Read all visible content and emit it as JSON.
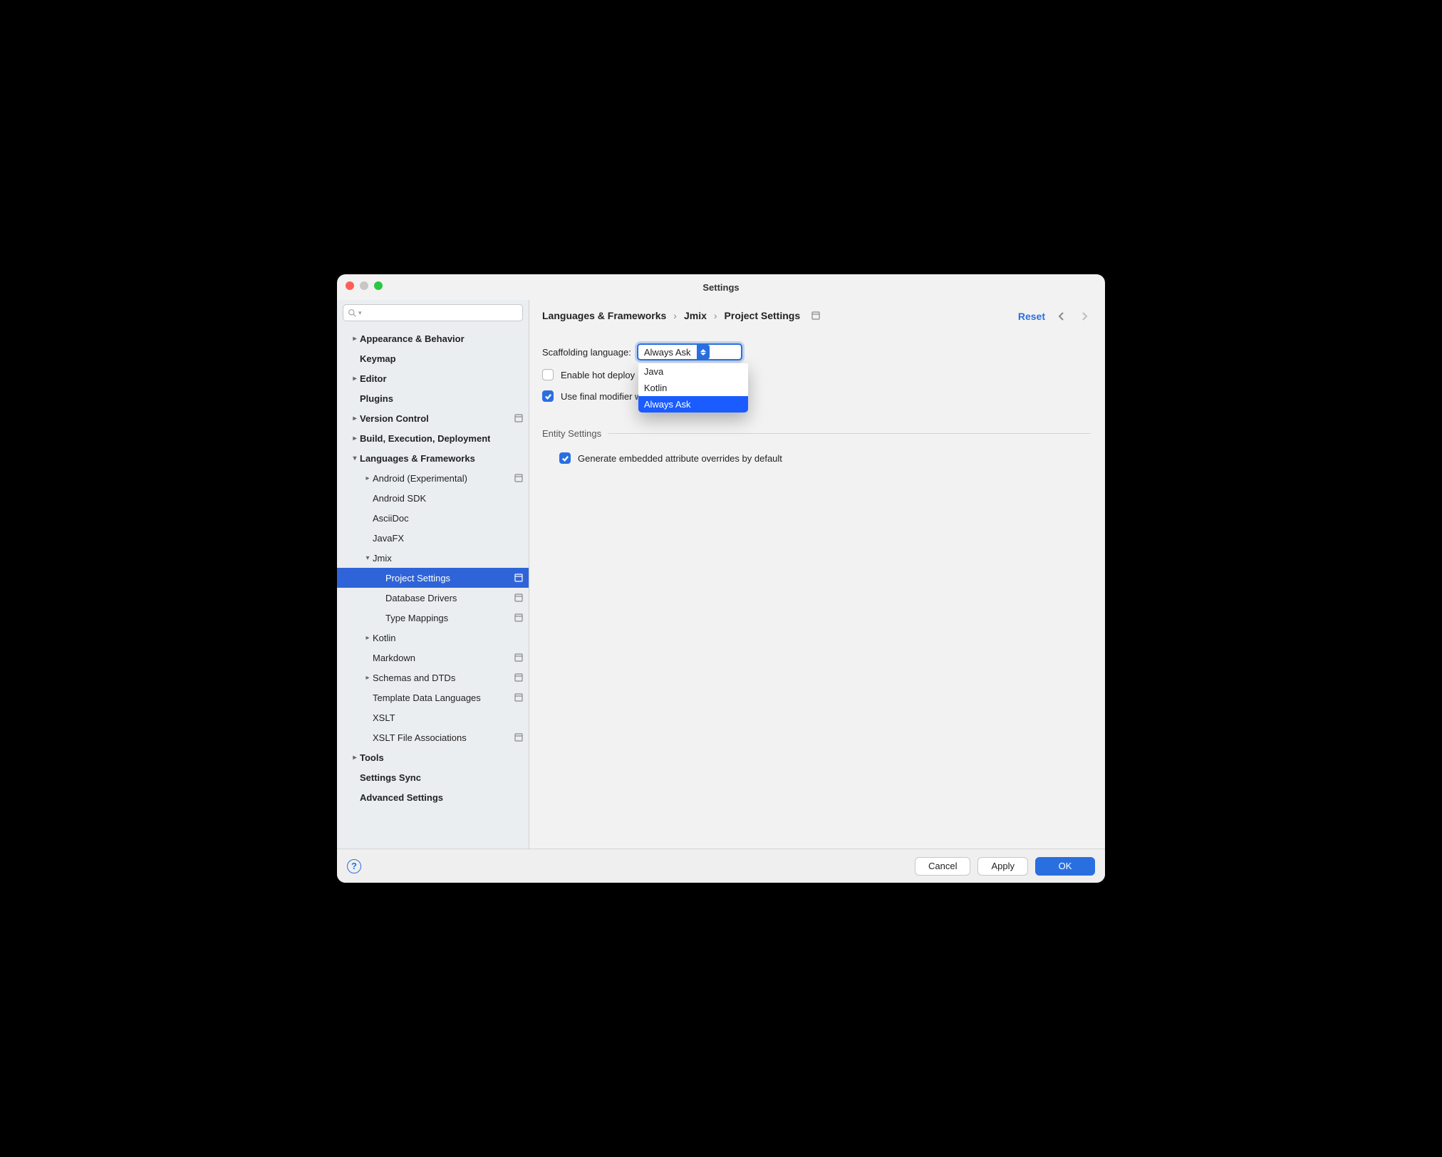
{
  "window": {
    "title": "Settings"
  },
  "search": {
    "placeholder": ""
  },
  "sidebar": {
    "items": [
      {
        "label": "Appearance & Behavior",
        "bold": true,
        "chev": "right",
        "indent": 0
      },
      {
        "label": "Keymap",
        "bold": true,
        "indent": 0
      },
      {
        "label": "Editor",
        "bold": true,
        "chev": "right",
        "indent": 0
      },
      {
        "label": "Plugins",
        "bold": true,
        "indent": 0
      },
      {
        "label": "Version Control",
        "bold": true,
        "chev": "right",
        "indent": 0,
        "proj": true
      },
      {
        "label": "Build, Execution, Deployment",
        "bold": true,
        "chev": "right",
        "indent": 0
      },
      {
        "label": "Languages & Frameworks",
        "bold": true,
        "chev": "down",
        "indent": 0
      },
      {
        "label": "Android (Experimental)",
        "chev": "right",
        "indent": 1,
        "proj": true
      },
      {
        "label": "Android SDK",
        "indent": 1
      },
      {
        "label": "AsciiDoc",
        "indent": 1
      },
      {
        "label": "JavaFX",
        "indent": 1
      },
      {
        "label": "Jmix",
        "chev": "down",
        "indent": 1
      },
      {
        "label": "Project Settings",
        "indent": 2,
        "selected": true,
        "proj": true
      },
      {
        "label": "Database Drivers",
        "indent": 2,
        "proj": true
      },
      {
        "label": "Type Mappings",
        "indent": 2,
        "proj": true
      },
      {
        "label": "Kotlin",
        "chev": "right",
        "indent": 1
      },
      {
        "label": "Markdown",
        "indent": 1,
        "proj": true
      },
      {
        "label": "Schemas and DTDs",
        "chev": "right",
        "indent": 1,
        "proj": true
      },
      {
        "label": "Template Data Languages",
        "indent": 1,
        "proj": true
      },
      {
        "label": "XSLT",
        "indent": 1
      },
      {
        "label": "XSLT File Associations",
        "indent": 1,
        "proj": true
      },
      {
        "label": "Tools",
        "bold": true,
        "chev": "right",
        "indent": 0
      },
      {
        "label": "Settings Sync",
        "bold": true,
        "indent": 0
      },
      {
        "label": "Advanced Settings",
        "bold": true,
        "indent": 0
      }
    ]
  },
  "breadcrumb": {
    "a": "Languages & Frameworks",
    "b": "Jmix",
    "c": "Project Settings"
  },
  "actions": {
    "reset": "Reset"
  },
  "form": {
    "scaffold_label": "Scaffolding language:",
    "scaffold_value": "Always Ask",
    "scaffold_options": [
      "Java",
      "Kotlin",
      "Always Ask"
    ],
    "enable_hot_deploy_label": "Enable hot deploy",
    "enable_hot_deploy_checked": false,
    "use_final_label_partial": "Use final modifier w",
    "use_final_checked": true,
    "entity_section": "Entity Settings",
    "generate_overrides_label": "Generate embedded attribute overrides by default",
    "generate_overrides_checked": true
  },
  "footer": {
    "cancel": "Cancel",
    "apply": "Apply",
    "ok": "OK"
  }
}
